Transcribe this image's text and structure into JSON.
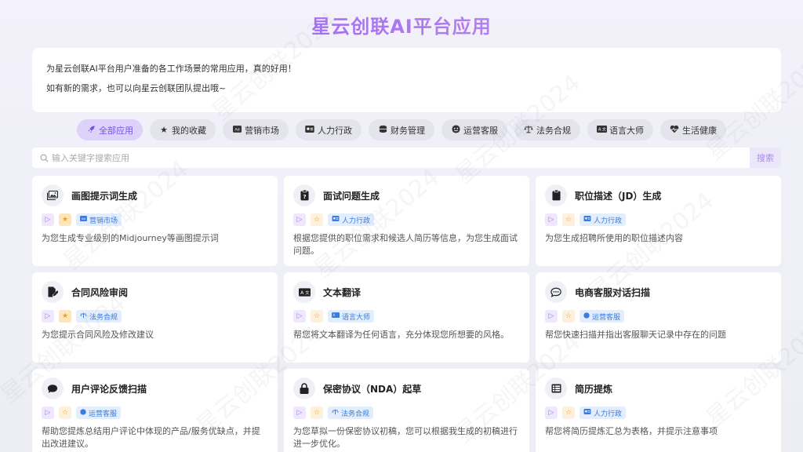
{
  "page_title": "星云创联AI平台应用",
  "intro": {
    "line1": "为星云创联AI平台用户准备的各工作场景的常用应用，真的好用！",
    "line2": "如有新的需求，也可以向星云创联团队提出哦~"
  },
  "tabs": [
    {
      "label": "全部应用",
      "icon": "rocket-icon"
    },
    {
      "label": "我的收藏",
      "icon": "star-icon"
    },
    {
      "label": "营销市场",
      "icon": "ad-icon"
    },
    {
      "label": "人力行政",
      "icon": "id-card-icon"
    },
    {
      "label": "财务管理",
      "icon": "coins-icon"
    },
    {
      "label": "运营客服",
      "icon": "headset-icon"
    },
    {
      "label": "法务合规",
      "icon": "scale-icon"
    },
    {
      "label": "语言大师",
      "icon": "language-icon"
    },
    {
      "label": "生活健康",
      "icon": "heart-pulse-icon"
    }
  ],
  "search": {
    "placeholder": "输入关键字搜索应用",
    "button_label": "搜索"
  },
  "cards": [
    {
      "title": "画图提示词生成",
      "icon": "image-icon",
      "starred": true,
      "category": "营销市场",
      "desc": "为您生成专业级别的Midjourney等画图提示词"
    },
    {
      "title": "面试问题生成",
      "icon": "clipboard-question-icon",
      "starred": false,
      "category": "人力行政",
      "desc": "根据您提供的职位需求和候选人简历等信息，为您生成面试问题。"
    },
    {
      "title": "职位描述（JD）生成",
      "icon": "clipboard-icon",
      "starred": false,
      "category": "人力行政",
      "desc": "为您生成招聘所使用的职位描述内容"
    },
    {
      "title": "合同风险审阅",
      "icon": "file-signature-icon",
      "starred": true,
      "category": "法务合规",
      "desc": "为您提示合同风险及修改建议"
    },
    {
      "title": "文本翻译",
      "icon": "language-icon",
      "starred": false,
      "category": "语言大师",
      "desc": "帮您将文本翻译为任何语言，充分体现您所想要的风格。"
    },
    {
      "title": "电商客服对话扫描",
      "icon": "chat-dots-icon",
      "starred": false,
      "category": "运营客服",
      "desc": "帮您快速扫描并指出客服聊天记录中存在的问题"
    },
    {
      "title": "用户评论反馈扫描",
      "icon": "comment-icon",
      "starred": false,
      "category": "运营客服",
      "desc": "帮助您提炼总结用户评论中体现的产品/服务优缺点，并提出改进建议。"
    },
    {
      "title": "保密协议（NDA）起草",
      "icon": "lock-icon",
      "starred": false,
      "category": "法务合规",
      "desc": "为您草拟一份保密协议初稿，您可以根据我生成的初稿进行进一步优化。"
    },
    {
      "title": "简历提炼",
      "icon": "table-list-icon",
      "starred": false,
      "category": "人力行政",
      "desc": "帮您将简历提炼汇总为表格，并提示注意事项"
    }
  ],
  "colors": {
    "accent": "#8a5cf6",
    "tag_blue": "#3b7be0",
    "star_orange": "#f2a21c"
  }
}
